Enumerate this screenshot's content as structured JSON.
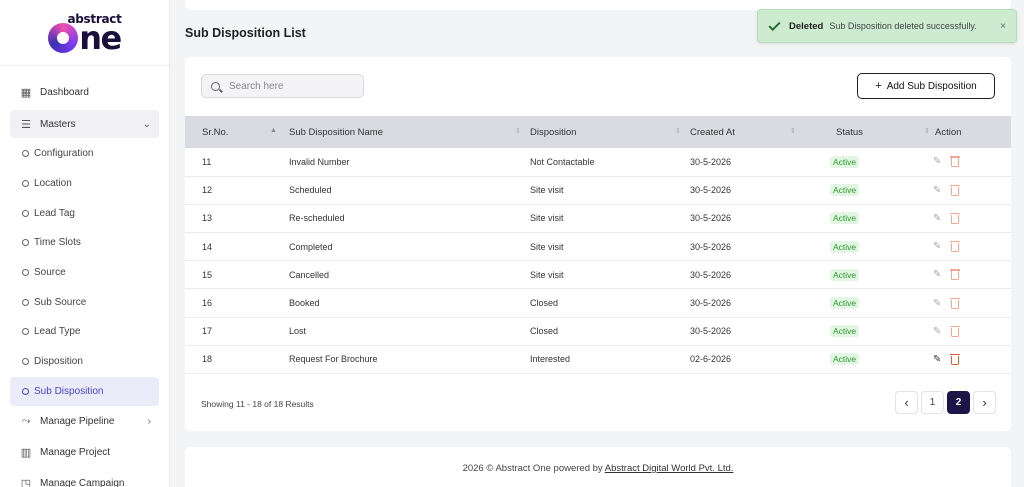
{
  "brand": {
    "line1": "abstract",
    "line2": "ne"
  },
  "sidebar": {
    "dashboard": "Dashboard",
    "masters": "Masters",
    "sub_items": [
      {
        "label": "Configuration"
      },
      {
        "label": "Location"
      },
      {
        "label": "Lead Tag"
      },
      {
        "label": "Time Slots"
      },
      {
        "label": "Source"
      },
      {
        "label": "Sub Source"
      },
      {
        "label": "Lead Type"
      },
      {
        "label": "Disposition"
      },
      {
        "label": "Sub Disposition",
        "active": true
      }
    ],
    "manage_pipeline": "Manage Pipeline",
    "manage_project": "Manage Project",
    "manage_campaign": "Manage Campaign"
  },
  "page": {
    "title": "Sub Disposition List"
  },
  "search": {
    "placeholder": "Search here"
  },
  "add_button": "Add Sub Disposition",
  "table": {
    "headers": [
      "Sr.No.",
      "Sub Disposition Name",
      "Disposition",
      "Created At",
      "Status",
      "Action"
    ],
    "rows": [
      {
        "sr": "11",
        "name": "Invalid Number",
        "disposition": "Not Contactable",
        "created": "30-5-2026",
        "status": "Active"
      },
      {
        "sr": "12",
        "name": "Scheduled",
        "disposition": "Site visit",
        "created": "30-5-2026",
        "status": "Active"
      },
      {
        "sr": "13",
        "name": "Re-scheduled",
        "disposition": "Site visit",
        "created": "30-5-2026",
        "status": "Active"
      },
      {
        "sr": "14",
        "name": "Completed",
        "disposition": "Site visit",
        "created": "30-5-2026",
        "status": "Active"
      },
      {
        "sr": "15",
        "name": "Cancelled",
        "disposition": "Site visit",
        "created": "30-5-2026",
        "status": "Active"
      },
      {
        "sr": "16",
        "name": "Booked",
        "disposition": "Closed",
        "created": "30-5-2026",
        "status": "Active"
      },
      {
        "sr": "17",
        "name": "Lost",
        "disposition": "Closed",
        "created": "30-5-2026",
        "status": "Active"
      },
      {
        "sr": "18",
        "name": "Request For Brochure",
        "disposition": "Interested",
        "created": "02-6-2026",
        "status": "Active"
      }
    ]
  },
  "pagination": {
    "showing": "Showing 11 - 18 of 18 Results",
    "pages": [
      "1",
      "2"
    ],
    "current": "2"
  },
  "footer": {
    "prefix": "2026 © Abstract One powered by ",
    "company": "Abstract Digital World Pvt. Ltd."
  },
  "toast": {
    "title": "Deleted",
    "message": "Sub Disposition deleted successfully.",
    "close": "×"
  },
  "icons": {
    "dashboard": "grid-icon",
    "masters": "list-icon",
    "pipeline": "pipeline-icon",
    "project": "building-icon",
    "campaign": "campaign-icon",
    "search": "search-icon",
    "edit": "pencil-icon",
    "delete": "trash-icon",
    "success": "check-icon"
  },
  "colors": {
    "accent": "#1d1448",
    "active_nav": "#4b43c7",
    "status_active": "#2c9a2c",
    "delete": "#e25a34",
    "toast_bg": "#ccebd0"
  }
}
